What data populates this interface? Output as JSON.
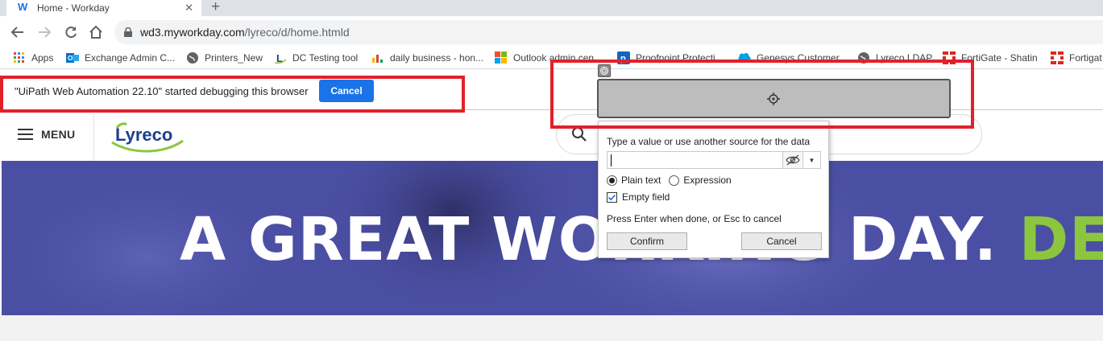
{
  "browser": {
    "tab": {
      "title": "Home - Workday",
      "favicon": "W"
    },
    "url_host": "wd3.myworkday.com",
    "url_path": "/lyreco/d/home.htmld"
  },
  "bookmarks": [
    {
      "label": "Apps",
      "icon": "apps-grid-icon"
    },
    {
      "label": "Exchange Admin C...",
      "icon": "outlook-icon"
    },
    {
      "label": "Printers_New",
      "icon": "globe-icon"
    },
    {
      "label": "DC Testing tool",
      "icon": "lyreco-l-icon"
    },
    {
      "label": "daily business - hon...",
      "icon": "chart-icon"
    },
    {
      "label": "Outlook admin cen...",
      "icon": "microsoft-icon"
    },
    {
      "label": "Proofpoint Protecti...",
      "icon": "proofpoint-icon"
    },
    {
      "label": "Genesys Customer...",
      "icon": "salesforce-icon"
    },
    {
      "label": "Lyreco LDAP",
      "icon": "globe-icon"
    },
    {
      "label": "FortiGate - Shatin",
      "icon": "fortinet-icon"
    },
    {
      "label": "Fortigat",
      "icon": "fortinet-icon"
    }
  ],
  "debug_bar": {
    "message": "\"UiPath Web Automation 22.10\" started debugging this browser",
    "cancel_label": "Cancel"
  },
  "site": {
    "menu_label": "MENU",
    "logo_text": "Lyreco",
    "hero_text": "A GREAT WORKING DAY.",
    "hero_accent": "DEL"
  },
  "popup": {
    "prompt": "Type a value or use another source for the data",
    "input_value": "",
    "option_plain": "Plain text",
    "option_expression": "Expression",
    "empty_field_label": "Empty field",
    "empty_field_checked": true,
    "hint": "Press Enter when done, or Esc to cancel",
    "confirm_label": "Confirm",
    "cancel_label": "Cancel"
  },
  "colors": {
    "highlight_red": "#e3202a",
    "chrome_blue": "#1a73e8",
    "hero_blue": "#4b4fa3",
    "lyreco_green": "#8cc63f"
  }
}
